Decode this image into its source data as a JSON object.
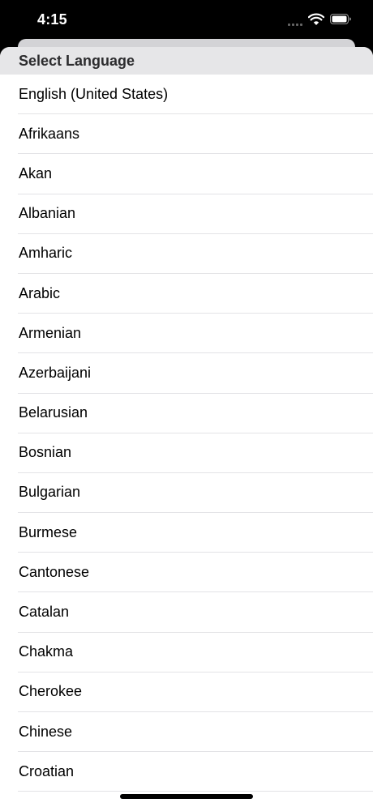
{
  "status_bar": {
    "time": "4:15"
  },
  "sheet": {
    "title": "Select Language"
  },
  "languages": [
    "English (United States)",
    "Afrikaans",
    "Akan",
    "Albanian",
    "Amharic",
    "Arabic",
    "Armenian",
    "Azerbaijani",
    "Belarusian",
    "Bosnian",
    "Bulgarian",
    "Burmese",
    "Cantonese",
    "Catalan",
    "Chakma",
    "Cherokee",
    "Chinese",
    "Croatian"
  ],
  "colors": {
    "status_bar_bg": "#000000",
    "header_bg": "#e6e6e8",
    "separator": "#e3e3e6",
    "text": "#000000"
  },
  "icons": [
    "signal-icon",
    "wifi-icon",
    "battery-icon"
  ]
}
